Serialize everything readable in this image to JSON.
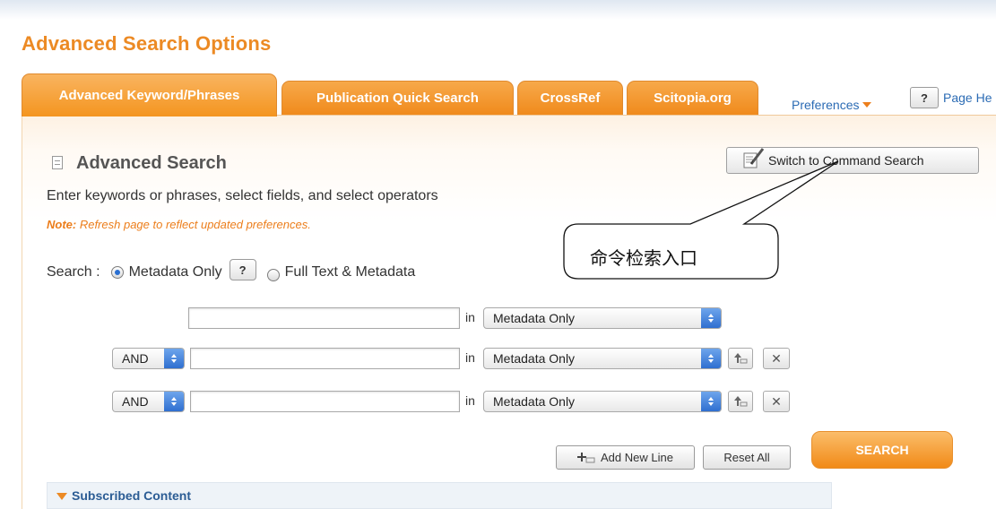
{
  "page": {
    "title": "Advanced Search Options"
  },
  "tabs": [
    {
      "label": "Advanced Keyword/Phrases",
      "active": true
    },
    {
      "label": "Publication Quick Search",
      "active": false
    },
    {
      "label": "CrossRef",
      "active": false
    },
    {
      "label": "Scitopia.org",
      "active": false
    }
  ],
  "header": {
    "preferences_label": "Preferences",
    "help_button_label": "?",
    "page_help_label": "Page He"
  },
  "section": {
    "title": "Advanced Search",
    "instructions": "Enter keywords or phrases, select fields, and select operators",
    "note_label": "Note:",
    "note_text": " Refresh page to reflect updated preferences."
  },
  "switch_button_label": "Switch to Command Search",
  "callout_text": "命令检索入口",
  "search_scope": {
    "label": "Search :",
    "options": [
      {
        "label": "Metadata Only",
        "selected": true
      },
      {
        "label": "Full Text & Metadata",
        "selected": false
      }
    ],
    "help_label": "?"
  },
  "rows": [
    {
      "operator": "",
      "query": "",
      "in_label": "in",
      "field": "Metadata Only"
    },
    {
      "operator": "AND",
      "query": "",
      "in_label": "in",
      "field": "Metadata Only"
    },
    {
      "operator": "AND",
      "query": "",
      "in_label": "in",
      "field": "Metadata Only"
    }
  ],
  "actions": {
    "add_line_label": "Add New Line",
    "reset_label": "Reset All",
    "search_label": "SEARCH"
  },
  "subscribed_label": "Subscribed Content",
  "colors": {
    "accent_orange": "#f08a1c",
    "title_orange": "#ec8a24",
    "link_blue": "#2b6bb4",
    "select_blue": "#2f6fd0"
  }
}
